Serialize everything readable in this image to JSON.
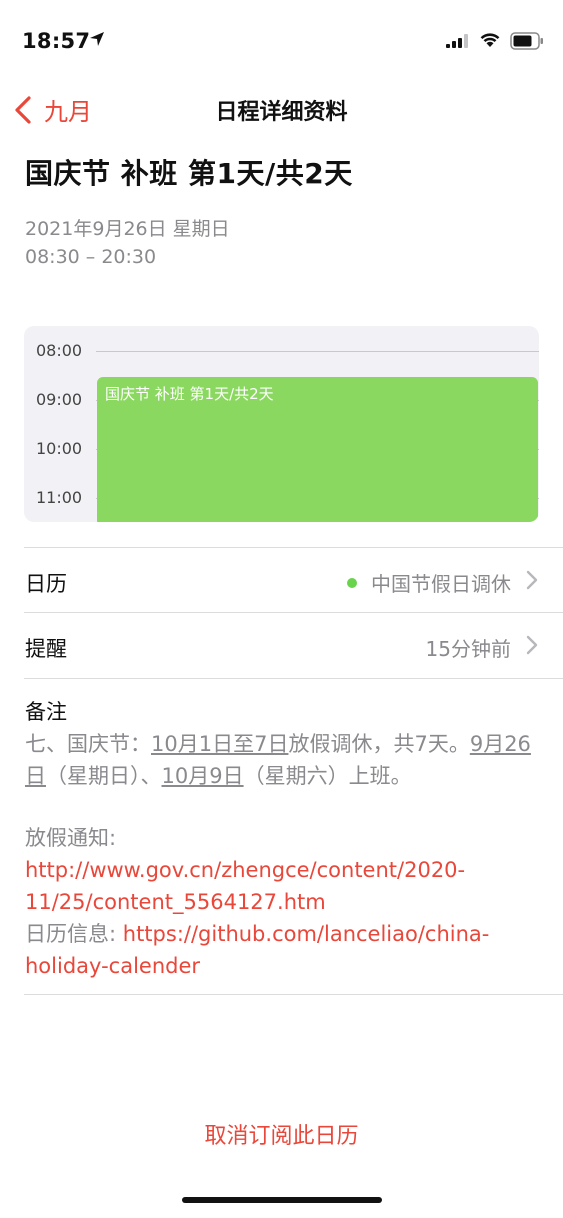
{
  "status": {
    "time": "18:57"
  },
  "nav": {
    "back_label": "九月",
    "title": "日程详细资料"
  },
  "event": {
    "title": "国庆节 补班 第1天/共2天",
    "date": "2021年9月26日 星期日",
    "time": "08:30 – 20:30"
  },
  "timeline": {
    "hours": [
      "08:00",
      "09:00",
      "10:00",
      "11:00"
    ],
    "event_label": "国庆节 补班 第1天/共2天",
    "event_color": "#8ad85f"
  },
  "calendar_row": {
    "label": "日历",
    "value": "中国节假日调休",
    "dot_color": "#6ad34c"
  },
  "alert_row": {
    "label": "提醒",
    "value": "15分钟前"
  },
  "notes": {
    "label": "备注",
    "t1": "七、国庆节：",
    "u1": "10月1日至7日",
    "t2": "放假调休，共7天。",
    "u2": "9月26日",
    "t3": "（星期日）、",
    "u3": "10月9日",
    "t4": "（星期六）上班。",
    "notice_prefix": "放假通知: ",
    "notice_url": "http://www.gov.cn/zhengce/content/2020-11/25/content_5564127.htm",
    "info_prefix": "日历信息: ",
    "info_url": "https://github.com/lanceliao/china-holiday-calender"
  },
  "unsubscribe_label": "取消订阅此日历",
  "colors": {
    "accent": "#e8473a",
    "secondary_text": "#8a8a8e"
  }
}
